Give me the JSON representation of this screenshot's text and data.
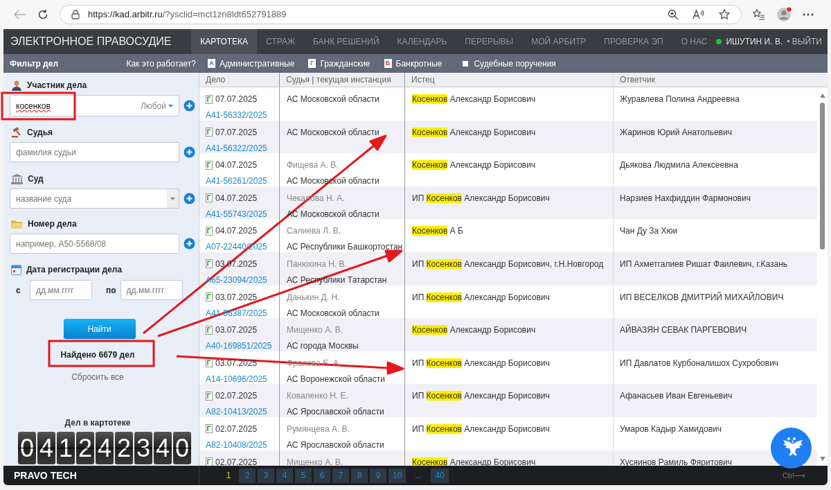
{
  "browser": {
    "url_host": "https://kad.arbitr.ru",
    "url_rest": "/?ysclid=mct1zn8ldt652791889"
  },
  "header": {
    "brand": "ЭЛЕКТРОННОЕ ПРАВОСУДИЕ",
    "nav": [
      {
        "label": "КАРТОТЕКА",
        "selected": true
      },
      {
        "label": "СТРАЖ",
        "selected": false
      },
      {
        "label": "БАНК РЕШЕНИЙ",
        "selected": false
      },
      {
        "label": "КАЛЕНДАРЬ",
        "selected": false
      },
      {
        "label": "ПЕРЕРЫВЫ",
        "selected": false
      },
      {
        "label": "МОЙ АРБИТР",
        "selected": false
      },
      {
        "label": "ПРОВЕРКА ЭП",
        "selected": false
      },
      {
        "label": "О НАС",
        "selected": false
      }
    ],
    "user": "ИШУТИН И. В.",
    "logout": "• ВЫЙТИ"
  },
  "filter_bar": {
    "title": "Фильтр дел",
    "help": "Как это работает?",
    "types": [
      {
        "kind": "badge",
        "badge": "А",
        "label": "Административные",
        "color": "#1e6fd0"
      },
      {
        "kind": "badge",
        "badge": "Г",
        "label": "Гражданские",
        "color": "#3aa53a"
      },
      {
        "kind": "badge",
        "badge": "Б",
        "label": "Банкротные",
        "color": "#d93030"
      },
      {
        "kind": "checkbox",
        "label": "Судебные поручения",
        "checked": false
      }
    ]
  },
  "filter": {
    "participant": {
      "label": "Участник дела",
      "value": "косенков",
      "role": "Любой"
    },
    "judge": {
      "label": "Судья",
      "placeholder": "фамилия судьи"
    },
    "court": {
      "label": "Суд",
      "placeholder": "название суда"
    },
    "case_number": {
      "label": "Номер дела",
      "placeholder": "например, А50-5568/08"
    },
    "date": {
      "label": "Дата регистрации дела",
      "from_label": "с",
      "from_placeholder": "дд.мм.гггг",
      "to_label": "по",
      "to_placeholder": "дд.мм.гггг"
    },
    "search_button": "Найти",
    "found": "Найдено 6679 дел",
    "reset": "Сбросить все",
    "counter_label": "Дел в картотеке",
    "counter": "041242340"
  },
  "table": {
    "columns": [
      "Дело",
      "Судья | текущая инстанция",
      "Истец",
      "Ответчик"
    ],
    "rows": [
      {
        "date": "07.07.2025",
        "number": "А41-56332/2025",
        "court": "АС Московской области",
        "plaintiff": {
          "match": "Косенков",
          "rest": "Александр Борисович"
        },
        "defendant": "Журавлева Полина Андреевна"
      },
      {
        "date": "07.07.2025",
        "number": "А41-56322/2025",
        "court": "АС Московской области",
        "plaintiff": {
          "match": "Косенков",
          "rest": "Александр Борисович"
        },
        "defendant": "Жаринов Юрий Анатольевич"
      },
      {
        "date": "04.07.2025",
        "number": "А41-56261/2025",
        "judge": "Фищева А. В.",
        "court": "АС Московской области",
        "plaintiff": {
          "match": "Косенков",
          "rest": "Александр Борисович"
        },
        "defendant": "Дьякова Людмила Алексеевна"
      },
      {
        "date": "04.07.2025",
        "number": "А41-55743/2025",
        "judge": "Чекалова Н. А.",
        "court": "АС Московской области",
        "plaintiff": {
          "prefix": "ИП",
          "match": "Косенков",
          "rest": "Александр Борисович"
        },
        "defendant": "Нарзиев Нахфиддин Фармонович"
      },
      {
        "date": "04.07.2025",
        "number": "А07-22440/2025",
        "judge": "Салиева Л. В.",
        "court": "АС Республики Башкортостан",
        "plaintiff": {
          "match": "Косенков",
          "rest": "А Б"
        },
        "defendant": "Чан Ду За Хюи"
      },
      {
        "date": "03.07.2025",
        "number": "А65-23094/2025",
        "judge": "Панюхина Н. В.",
        "court": "АС Республики Татарстан",
        "plaintiff": {
          "prefix": "ИП",
          "match": "Косенков",
          "rest": "Александр Борисович, г.Н.Новгород"
        },
        "defendant": "ИП Ахметгалиев Ришат Фаилевич, г.Казань"
      },
      {
        "date": "03.07.2025",
        "number": "А41-56387/2025",
        "judge": "Данькин Д. Н.",
        "court": "АС Московской области",
        "plaintiff": {
          "prefix": "ИП",
          "match": "Косенков",
          "rest": "Александр Борисович"
        },
        "defendant": "ИП ВЕСЕЛКОВ ДМИТРИЙ МИХАЙЛОВИЧ"
      },
      {
        "date": "03.07.2025",
        "number": "А40-169851/2025",
        "judge": "Мищенко А. В.",
        "court": "АС города Москвы",
        "plaintiff": {
          "match": "Косенков",
          "rest": "Александр Борисович"
        },
        "defendant": "АЙВАЗЯН СЕВАК ПАРГЕВОВИЧ"
      },
      {
        "date": "03.07.2025",
        "number": "А14-10696/2025",
        "judge": "Фролова Е. А.",
        "court": "АС Воронежской области",
        "plaintiff": {
          "prefix": "ИП",
          "match": "Косенков",
          "rest": "Александр Борисович"
        },
        "defendant": "ИП Давлатов Курбоналишох Сухробович"
      },
      {
        "date": "02.07.2025",
        "number": "А82-10413/2025",
        "judge": "Коваленко Н. Е.",
        "court": "АС Ярославской области",
        "plaintiff": {
          "prefix": "ИП",
          "match": "Косенков",
          "rest": "Александр Борисович"
        },
        "defendant": "Афанасьев Иван Евгеньевич"
      },
      {
        "date": "02.07.2025",
        "number": "А82-10408/2025",
        "judge": "Румянцева А. В.",
        "court": "АС Ярославской области",
        "plaintiff": {
          "prefix": "ИП",
          "match": "Косенков",
          "rest": "Александр Борисович"
        },
        "defendant": "Умаров Кадыр Хамидович"
      },
      {
        "date": "02.07.2025",
        "judge": "Мищенко А. В.",
        "plaintiff": {
          "match": "Косенков",
          "rest": "Александр Борисович"
        },
        "defendant": "Хусяинов Рамиль Фяритович"
      }
    ]
  },
  "footer": {
    "brand": "PRAVO TECH",
    "pages": [
      {
        "label": "1",
        "selected": true
      },
      {
        "label": "2",
        "selected": false
      },
      {
        "label": "3",
        "selected": false
      },
      {
        "label": "4",
        "selected": false
      },
      {
        "label": "5",
        "selected": false
      },
      {
        "label": "6",
        "selected": false
      },
      {
        "label": "7",
        "selected": false
      },
      {
        "label": "8",
        "selected": false
      },
      {
        "label": "9",
        "selected": false
      },
      {
        "label": "10",
        "selected": false
      },
      {
        "label": "...",
        "kind": "gap"
      },
      {
        "label": "40",
        "selected": false
      }
    ],
    "shortcut": "Ctrl⟶"
  }
}
